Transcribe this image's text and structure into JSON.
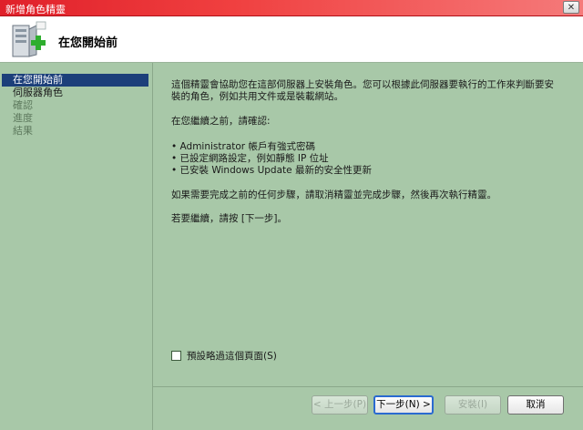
{
  "window": {
    "title": "新增角色精靈",
    "close_glyph": "✕"
  },
  "header": {
    "title": "在您開始前"
  },
  "sidebar": {
    "items": [
      {
        "label": "在您開始前",
        "state": "active"
      },
      {
        "label": "伺服器角色",
        "state": "normal"
      },
      {
        "label": "確認",
        "state": "disabled"
      },
      {
        "label": "進度",
        "state": "disabled"
      },
      {
        "label": "結果",
        "state": "disabled"
      }
    ]
  },
  "content": {
    "intro": "這個精靈會協助您在這部伺服器上安裝角色。您可以根據此伺服器要執行的工作來判斷要安裝的角色，例如共用文件或是裝載網站。",
    "before_continue": "在您繼續之前，請確認:",
    "bullets": [
      "• Administrator 帳戶有強式密碼",
      "• 已設定網路設定，例如靜態 IP 位址",
      "• 已安裝 Windows Update 最新的安全性更新"
    ],
    "cancel_note": "如果需要完成之前的任何步驟，請取消精靈並完成步驟，然後再次執行精靈。",
    "continue_note": "若要繼續，請按 [下一步]。",
    "skip_label": "預設略過這個頁面(S)",
    "skip_checked": false
  },
  "buttons": {
    "back": "< 上一步(P)",
    "next": "下一步(N) >",
    "install": "安裝(I)",
    "cancel": "取消"
  },
  "colors": {
    "accent": "#1c3f7a",
    "titlebar": "#e0202a",
    "background": "#a8c8a8"
  },
  "icons": {
    "wizard": "server-add-icon",
    "close": "close-icon"
  }
}
